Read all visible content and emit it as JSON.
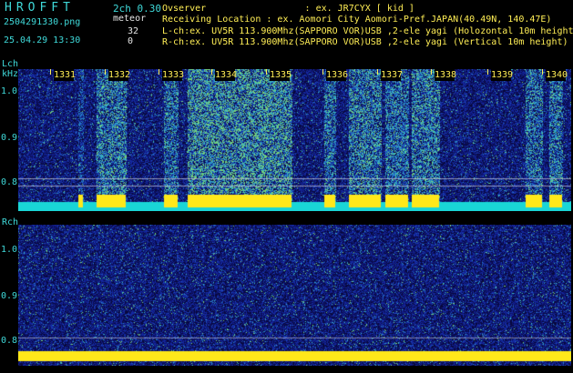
{
  "header": {
    "app_title": "HROFFT",
    "file_name": "2504291330.png",
    "timestamp": "25.04.29 13:30",
    "mode": "2ch 0.30",
    "kind": "meteor",
    "lch_count": "32",
    "rch_count": "0",
    "observer": "Ovserver                  : ex. JR7CYX [ kid ]",
    "location": "Receiving Location : ex. Aomori City Aomori-Pref.JAPAN(40.49N, 140.47E)",
    "lch_info": "L-ch:ex. UV5R 113.900Mhz(SAPPORO VOR)USB ,2-ele yagi (Holozontal 10m height)",
    "rch_info": "R-ch:ex. UV5R 113.900Mhz(SAPPORO VOR)USB ,2-ele yagi (Vertical 10m height)"
  },
  "axis": {
    "lch_label": "Lch",
    "khz_label": "kHz",
    "rch_label": "Rch",
    "lch_ticks": [
      "1.0",
      "0.9",
      "0.8"
    ],
    "rch_ticks": [
      "1.0",
      "0.9",
      "0.8"
    ],
    "time_markers": [
      "1331",
      "1332",
      "1333",
      "1334",
      "1335",
      "1336",
      "1337",
      "1338",
      "1339",
      "1340"
    ]
  },
  "colors": {
    "background": "#000000",
    "label_cyan": "#3fd9d9",
    "label_yellow": "#ffee55",
    "trace_yellow": "#ffe81a"
  }
}
